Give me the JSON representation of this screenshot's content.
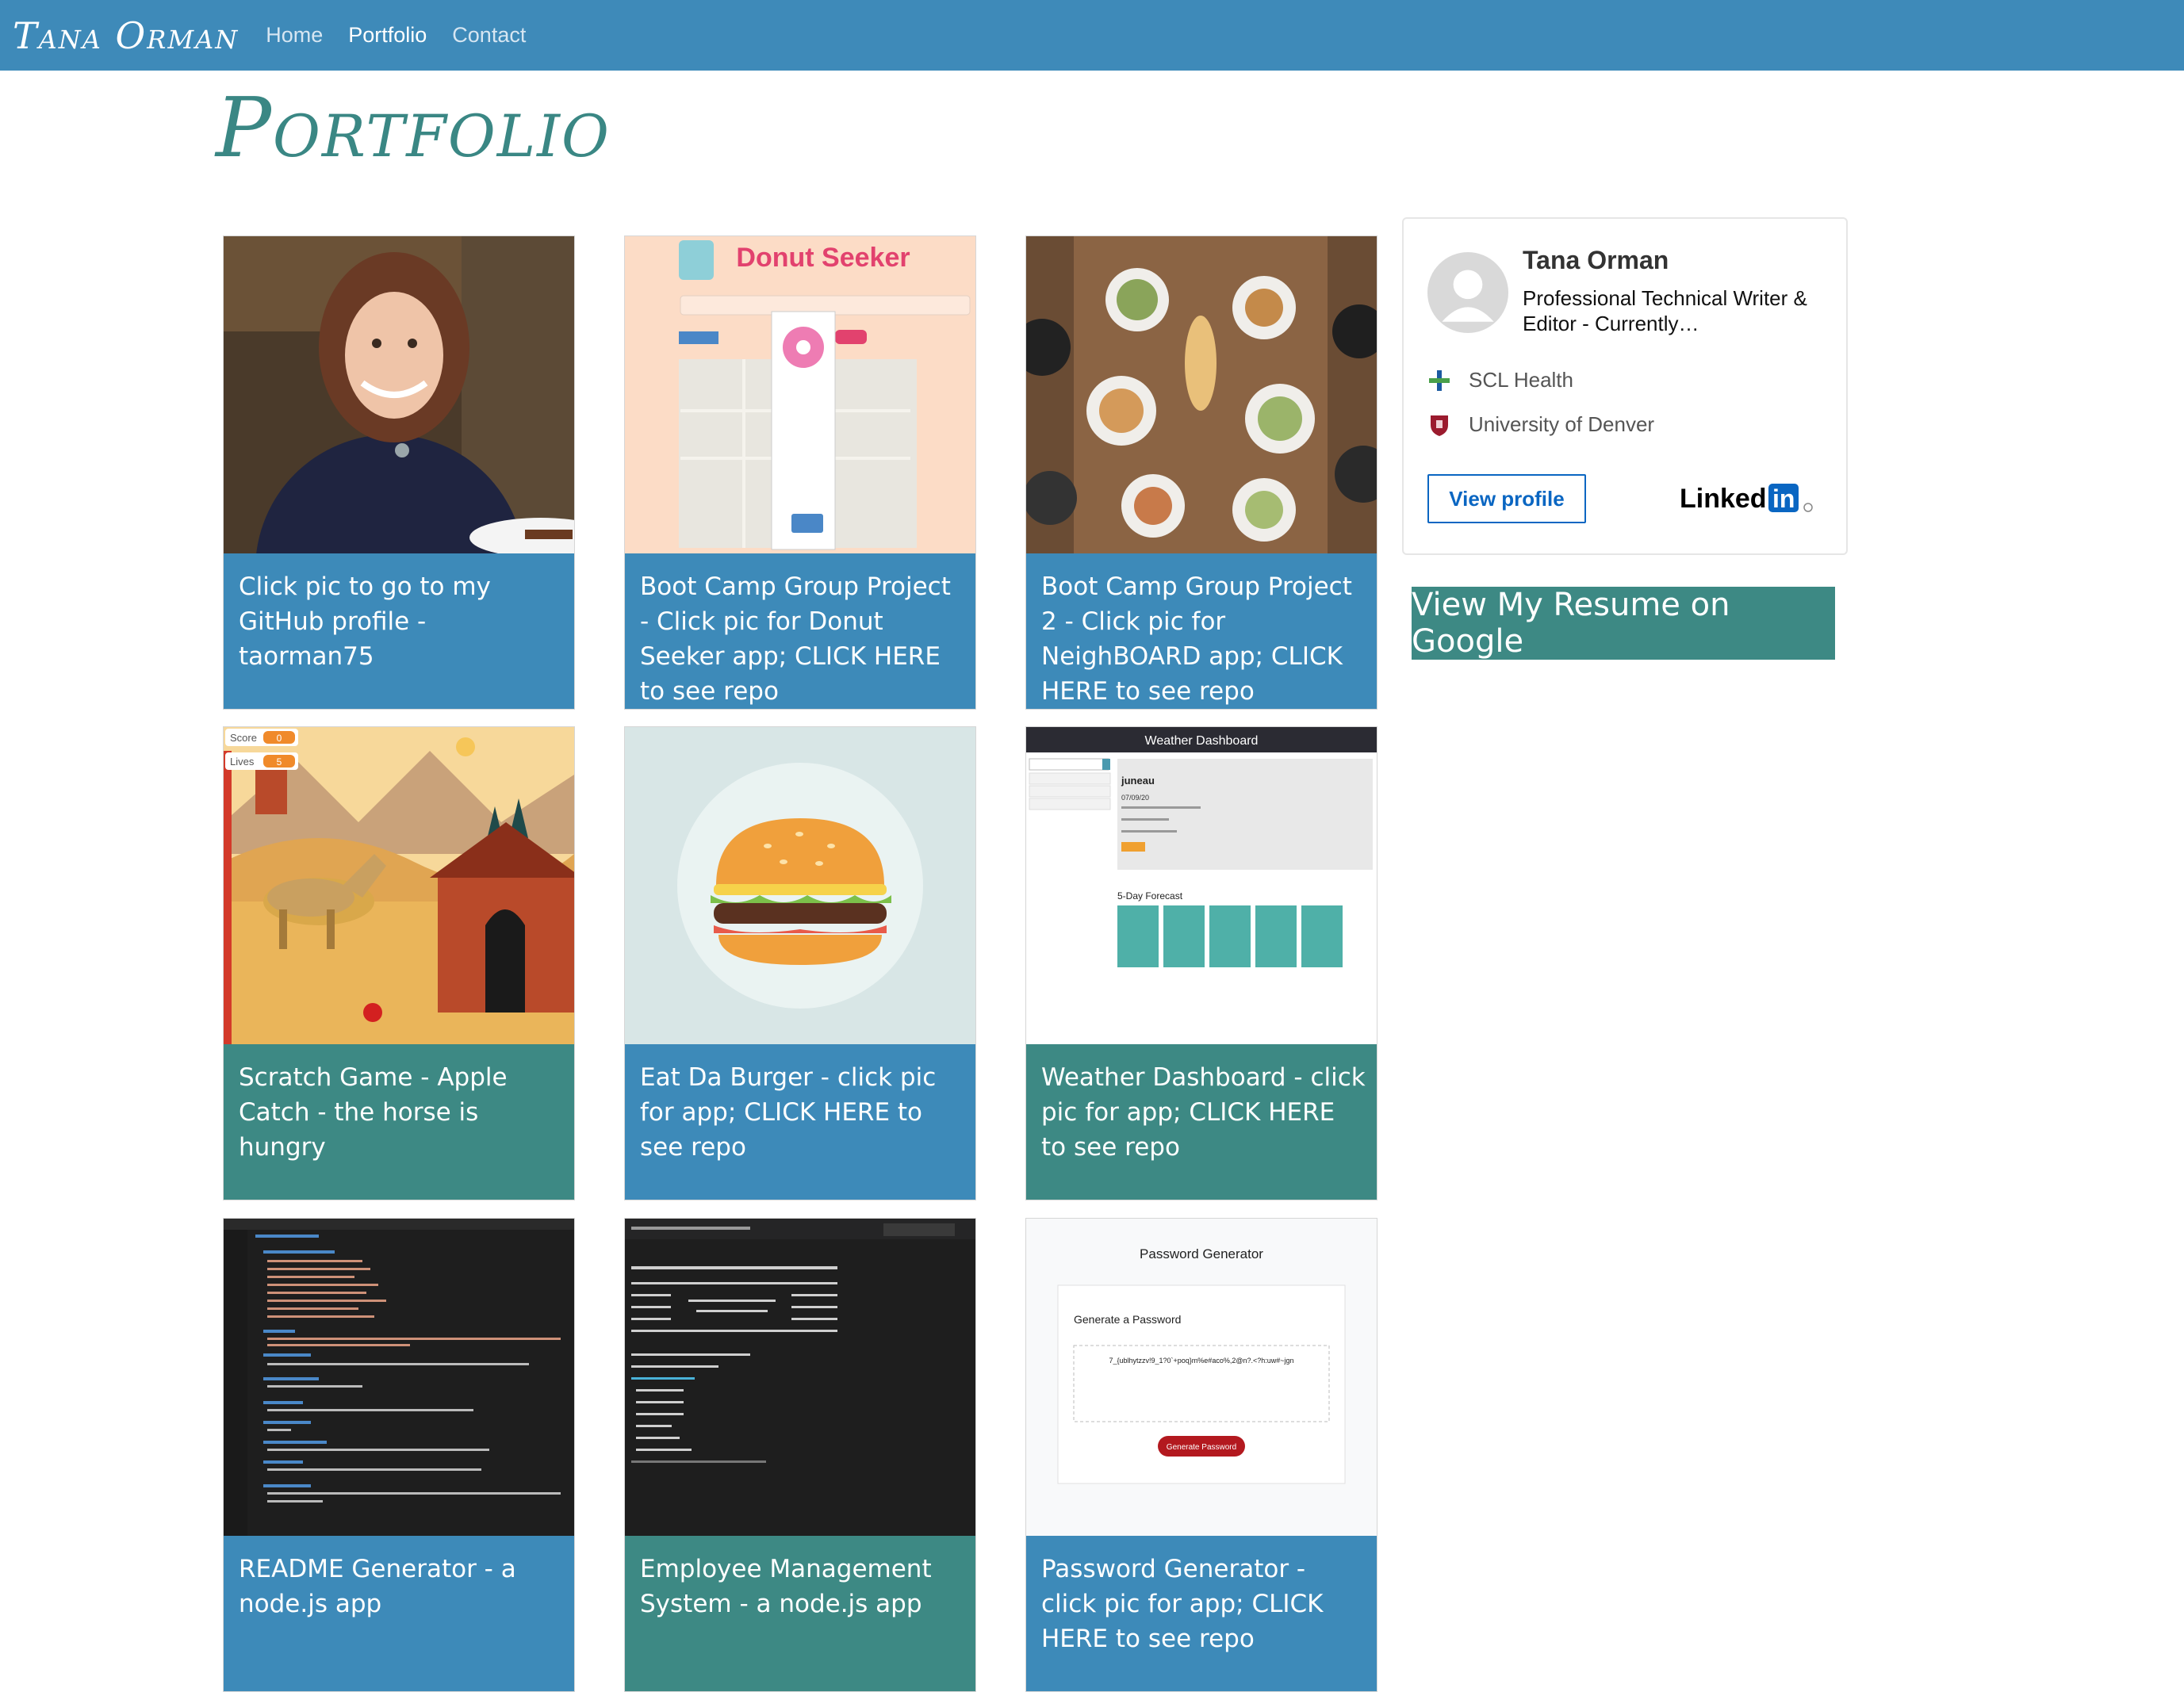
{
  "nav": {
    "brand": "Tana Orman",
    "links": [
      {
        "label": "Home",
        "active": false
      },
      {
        "label": "Portfolio",
        "active": true
      },
      {
        "label": "Contact",
        "active": false
      }
    ]
  },
  "page": {
    "title": "Portfolio"
  },
  "cards": [
    {
      "caption": "Click pic to go to my GitHub profile - taorman75",
      "color": "blue",
      "image": "profile-photo"
    },
    {
      "caption": "Boot Camp Group Project - Click pic for Donut Seeker app; CLICK HERE to see repo",
      "color": "blue",
      "image": "donut-seeker-screenshot",
      "image_text": "Donut Seeker"
    },
    {
      "caption": "Boot Camp Group Project 2 - Click pic for NeighBOARD app; CLICK HERE to see repo",
      "color": "blue",
      "image": "dinner-table-photo"
    },
    {
      "caption": "Scratch Game - Apple Catch - the horse is hungry",
      "color": "teal",
      "image": "scratch-game-screenshot",
      "image_text": {
        "score": "Score",
        "score_value": "0",
        "lives": "Lives",
        "lives_value": "5"
      }
    },
    {
      "caption": "Eat Da Burger - click pic for app; CLICK HERE to see repo",
      "color": "blue",
      "image": "burger-illustration"
    },
    {
      "caption": "Weather Dashboard - click pic for app; CLICK HERE to see repo",
      "color": "teal",
      "image": "weather-dashboard-screenshot",
      "image_text": {
        "header": "Weather Dashboard",
        "city": "juneau",
        "date": "07/09/20",
        "forecast": "5-Day Forecast"
      }
    },
    {
      "caption": "README Generator - a node.js app",
      "color": "blue",
      "image": "code-editor-screenshot"
    },
    {
      "caption": "Employee Management System - a node.js app",
      "color": "teal",
      "image": "terminal-screenshot"
    },
    {
      "caption": "Password Generator - click pic for app; CLICK HERE to see repo",
      "color": "blue",
      "image": "password-generator-screenshot",
      "image_text": {
        "title": "Password Generator",
        "subtitle": "Generate a Password",
        "password": "7_{ublhytzzv!9_1?0`+poq}m%e#aco%,2@n?.<?h:uw#~jgn",
        "button": "Generate Password"
      }
    }
  ],
  "linkedin": {
    "name": "Tana Orman",
    "headline": "Professional Technical Writer & Editor - Currently…",
    "rows": [
      "SCL Health",
      "University of Denver"
    ],
    "button": "View profile",
    "logo": "LinkedIn"
  },
  "resume_button": "View My Resume on Google",
  "colors": {
    "navbar": "#3e8ab9",
    "card_blue": "#3d8ab9",
    "card_teal": "#3d8984",
    "title": "#3a8784"
  }
}
